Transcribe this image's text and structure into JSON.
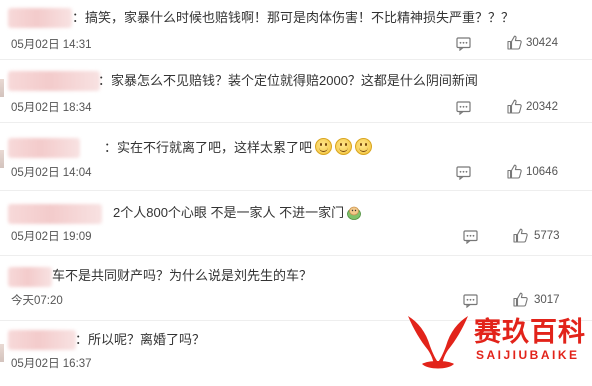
{
  "comments": [
    {
      "text": "：搞笑，家暴什么时候也赔钱啊！那可是肉体伤害！不比精神损失严重？？？",
      "time": "05月02日 14:31",
      "likes": "30424"
    },
    {
      "text": "：家暴怎么不见赔钱？装个定位就得赔2000？这都是什么阴间新闻",
      "time": "05月02日 18:34",
      "likes": "20342"
    },
    {
      "text": "：实在不行就离了吧，这样太累了吧",
      "time": "05月02日 14:04",
      "likes": "10646"
    },
    {
      "text": "2个人800个心眼 不是一家人 不进一家门",
      "time": "05月02日 19:09",
      "likes": "5773"
    },
    {
      "text": "车不是共同财产吗？为什么说是刘先生的车？",
      "time": "今天07:20",
      "likes": "3017"
    },
    {
      "text": "：所以呢？离婚了吗？",
      "time": "05月02日 16:37",
      "likes": ""
    }
  ],
  "watermark": {
    "title": "赛玖百科",
    "subtitle": "SAIJIUBAIKE",
    "color": "#e2231a"
  },
  "icons": {
    "reply": "comment-bubble-icon",
    "like": "thumbs-up-icon"
  }
}
